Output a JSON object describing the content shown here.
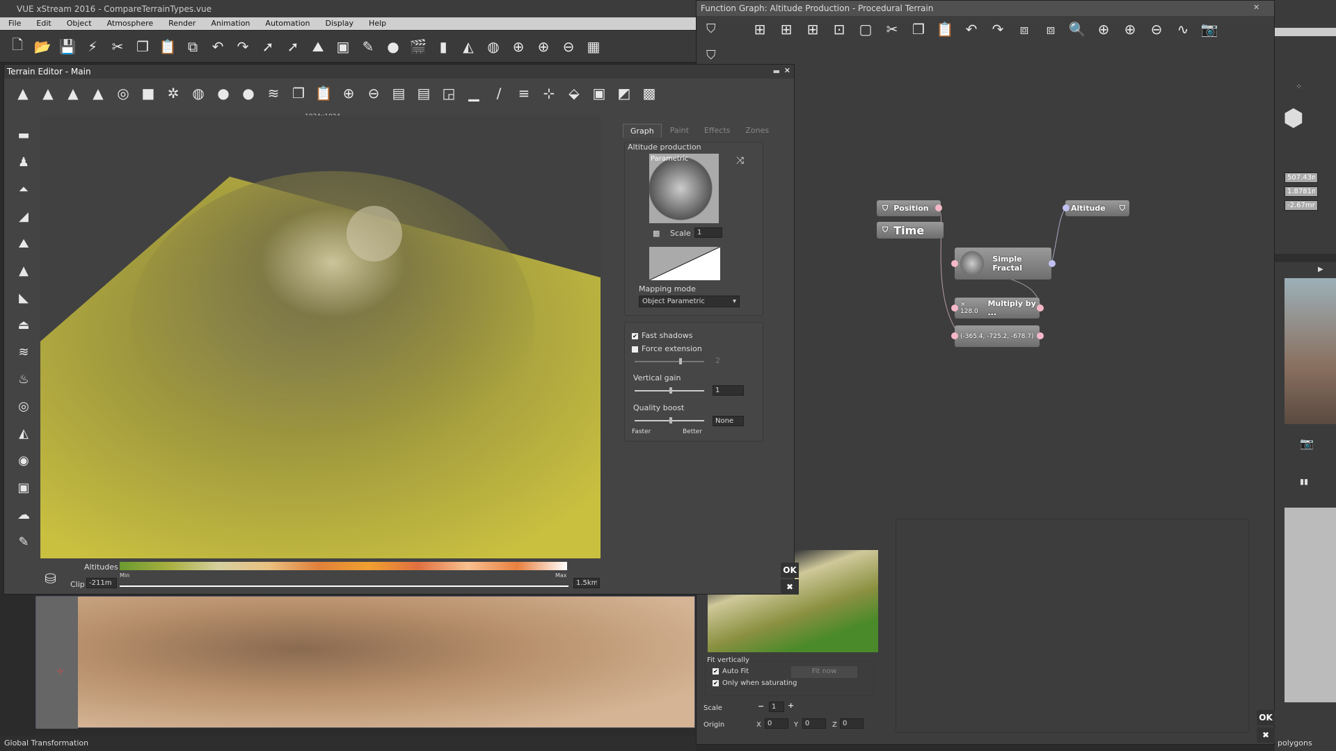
{
  "app": {
    "title": "VUE xStream 2016 - CompareTerrainTypes.vue"
  },
  "menu": [
    "File",
    "Edit",
    "Object",
    "Atmosphere",
    "Render",
    "Animation",
    "Automation",
    "Display",
    "Help"
  ],
  "main_toolbar": [
    [
      "new-icon",
      "🗋"
    ],
    [
      "open-icon",
      "📂"
    ],
    [
      "save-icon",
      "💾"
    ],
    [
      "save-incremental-icon",
      "⚡"
    ],
    [
      "cut-icon",
      "✂"
    ],
    [
      "copy-icon",
      "❐"
    ],
    [
      "paste-icon",
      "📋"
    ],
    [
      "duplicate-icon",
      "⧉"
    ],
    [
      "undo-icon",
      "↶"
    ],
    [
      "redo-icon",
      "↷"
    ],
    [
      "select-icon",
      "➚"
    ],
    [
      "select-drag-icon",
      "➚"
    ],
    [
      "terrain-icon",
      "⛰"
    ],
    [
      "object-icon",
      "▣"
    ],
    [
      "material-icon",
      "✎"
    ],
    [
      "atmosphere-icon",
      "●"
    ],
    [
      "render-icon",
      "🎬"
    ],
    [
      "align-icon",
      "▮"
    ],
    [
      "mirror-icon",
      "◭"
    ],
    [
      "globe-icon",
      "◍"
    ],
    [
      "zoom-region-icon",
      "⊕"
    ],
    [
      "zoom-in-icon",
      "⊕"
    ],
    [
      "zoom-out-icon",
      "⊖"
    ],
    [
      "view-icon",
      "▦"
    ]
  ],
  "terrain_editor": {
    "title": "Terrain Editor - Main",
    "resolution": "1024x1024",
    "toolbar": [
      [
        "raise-icon",
        "▲"
      ],
      [
        "lower-icon",
        "▲"
      ],
      [
        "peaks-icon",
        "▲"
      ],
      [
        "erode-icon",
        "▲"
      ],
      [
        "filter-icon",
        "◎"
      ],
      [
        "flat-icon",
        "■"
      ],
      [
        "plants-icon",
        "✲"
      ],
      [
        "sphere-grid-icon",
        "◍"
      ],
      [
        "sphere-icon",
        "●"
      ],
      [
        "sphere-rough-icon",
        "●"
      ],
      [
        "layers-icon",
        "≋"
      ],
      [
        "copy-icon",
        "❐"
      ],
      [
        "paste-icon",
        "📋"
      ],
      [
        "zoom-in-icon",
        "⊕"
      ],
      [
        "zoom-out-icon",
        "⊖"
      ],
      [
        "shrink-icon",
        "▤"
      ],
      [
        "grow-icon",
        "▤"
      ],
      [
        "resize-icon",
        "◲"
      ],
      [
        "histogram-icon",
        "▁"
      ],
      [
        "curve-icon",
        "∕"
      ],
      [
        "stack-icon",
        "≡"
      ],
      [
        "split-icon",
        "⊹"
      ],
      [
        "export-icon",
        "⬙"
      ],
      [
        "fit-icon",
        "▣"
      ],
      [
        "2d-icon",
        "◩"
      ],
      [
        "checker-icon",
        "▩"
      ]
    ],
    "vertical_tools": [
      [
        "line-icon",
        "▬"
      ],
      [
        "stamp-icon",
        "♟"
      ],
      [
        "brush-raise-icon",
        "⏶"
      ],
      [
        "brush-smooth-icon",
        "◢"
      ],
      [
        "brush-mountain-icon",
        "⛰"
      ],
      [
        "brush-peak-icon",
        "▲"
      ],
      [
        "brush-flatten-icon",
        "◣"
      ],
      [
        "brush-plateau-icon",
        "⏏"
      ],
      [
        "brush-erode-icon",
        "≋"
      ],
      [
        "brush-wind-icon",
        "♨"
      ],
      [
        "brush-fractal-icon",
        "◎"
      ],
      [
        "brush-terrace-icon",
        "◭"
      ],
      [
        "brush-eye-icon",
        "◉"
      ],
      [
        "brush-portrait-icon",
        "▣"
      ],
      [
        "brush-cloud-icon",
        "☁"
      ],
      [
        "brush-paint-icon",
        "✎"
      ]
    ],
    "tabs": [
      "Graph",
      "Paint",
      "Effects",
      "Zones"
    ],
    "active_tab": "Graph",
    "altitude_production": {
      "label": "Altitude production",
      "preview_label": "Parametric",
      "scale_label": "Scale",
      "scale_value": "1",
      "mapping_label": "Mapping mode",
      "mapping_value": "Object Parametric"
    },
    "options": {
      "fast_shadows": "Fast shadows",
      "fast_shadows_checked": true,
      "force_extension": "Force extension",
      "force_extension_checked": false,
      "extension_value": "2",
      "vertical_gain_label": "Vertical gain",
      "vertical_gain_value": "1",
      "quality_boost_label": "Quality boost",
      "quality_boost_value": "None",
      "faster": "Faster",
      "better": "Better"
    },
    "altitudes": {
      "label": "Altitudes",
      "min": "Min",
      "max": "Max",
      "clip_label": "Clip",
      "clip_min": "-211m",
      "clip_max": "1.5km"
    },
    "ok": "OK",
    "cancel": "✖"
  },
  "function_graph": {
    "title": "Function Graph: Altitude Production - Procedural Terrain",
    "toolbar": [
      [
        "add-node-icon",
        "⊞"
      ],
      [
        "insert-node-icon",
        "⊞"
      ],
      [
        "replace-node-icon",
        "⊞"
      ],
      [
        "group-icon",
        "⊡"
      ],
      [
        "comment-icon",
        "▢"
      ],
      [
        "cut-icon",
        "✂"
      ],
      [
        "copy-icon",
        "❐"
      ],
      [
        "paste-icon",
        "📋"
      ],
      [
        "undo-icon",
        "↶"
      ],
      [
        "redo-icon",
        "↷"
      ],
      [
        "fit-icon",
        "⧈"
      ],
      [
        "fit-all-icon",
        "⧈"
      ],
      [
        "find-icon",
        "🔍"
      ],
      [
        "zoom-region-icon",
        "⊕"
      ],
      [
        "zoom-in-icon",
        "⊕"
      ],
      [
        "zoom-out-icon",
        "⊖"
      ],
      [
        "graph-icon",
        "∿"
      ],
      [
        "snapshot-icon",
        "📷"
      ]
    ],
    "nodes": {
      "position": "Position",
      "time": "Time",
      "fractal": "Simple Fractal",
      "multiply_value": "× 128.0",
      "multiply": "Multiply by ...",
      "vector": "(-365.4, -725.2, -678.7)",
      "altitude": "Altitude"
    },
    "fit": {
      "label": "Fit vertically",
      "auto_fit": "Auto Fit",
      "only_saturating": "Only when saturating",
      "fit_now": "Fit now",
      "scale_label": "Scale",
      "scale_value": "1",
      "origin_label": "Origin",
      "x": "0",
      "y": "0",
      "z": "0"
    },
    "ok": "OK",
    "cancel": "✖"
  },
  "right_panel": {
    "values": [
      "507.43m",
      "1.8781m",
      "-2.67mm"
    ],
    "dropdown": "polygons"
  },
  "status": "Global Transformation",
  "colors": {
    "pin_pink": "#f5b8c8",
    "pin_blue": "#c0c0f0",
    "terrain": "#b6ad3c"
  }
}
